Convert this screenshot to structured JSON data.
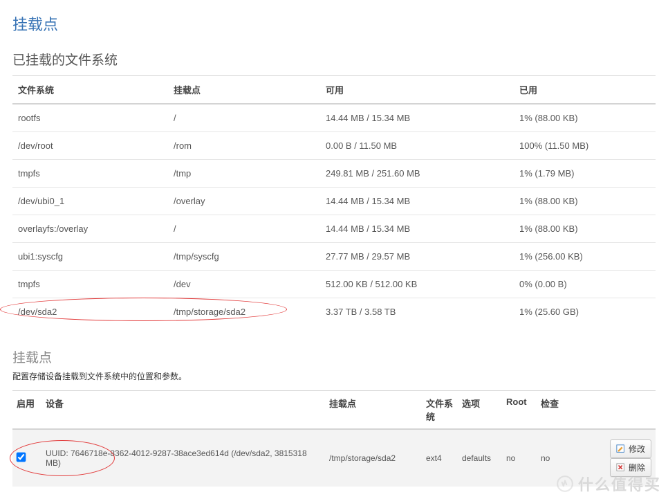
{
  "page": {
    "title": "挂载点"
  },
  "mounted": {
    "heading": "已挂载的文件系统",
    "columns": {
      "fs": "文件系统",
      "mount": "挂载点",
      "avail": "可用",
      "used": "已用"
    },
    "rows": [
      {
        "fs": "rootfs",
        "mount": "/",
        "avail": "14.44 MB / 15.34 MB",
        "used": "1% (88.00 KB)"
      },
      {
        "fs": "/dev/root",
        "mount": "/rom",
        "avail": "0.00 B / 11.50 MB",
        "used": "100% (11.50 MB)"
      },
      {
        "fs": "tmpfs",
        "mount": "/tmp",
        "avail": "249.81 MB / 251.60 MB",
        "used": "1% (1.79 MB)"
      },
      {
        "fs": "/dev/ubi0_1",
        "mount": "/overlay",
        "avail": "14.44 MB / 15.34 MB",
        "used": "1% (88.00 KB)"
      },
      {
        "fs": "overlayfs:/overlay",
        "mount": "/",
        "avail": "14.44 MB / 15.34 MB",
        "used": "1% (88.00 KB)"
      },
      {
        "fs": "ubi1:syscfg",
        "mount": "/tmp/syscfg",
        "avail": "27.77 MB / 29.57 MB",
        "used": "1% (256.00 KB)"
      },
      {
        "fs": "tmpfs",
        "mount": "/dev",
        "avail": "512.00 KB / 512.00 KB",
        "used": "0% (0.00 B)"
      },
      {
        "fs": "/dev/sda2",
        "mount": "/tmp/storage/sda2",
        "avail": "3.37 TB / 3.58 TB",
        "used": "1% (25.60 GB)"
      }
    ]
  },
  "mountpoints": {
    "heading": "挂载点",
    "desc": "配置存储设备挂载到文件系统中的位置和参数。",
    "columns": {
      "enable": "启用",
      "device": "设备",
      "mount": "挂载点",
      "fs": "文件系统",
      "options": "选项",
      "root": "Root",
      "check": "检查"
    },
    "rows": [
      {
        "enabled": true,
        "device": "UUID: 7646718e-8362-4012-9287-38ace3ed614d (/dev/sda2, 3815318 MB)",
        "mount": "/tmp/storage/sda2",
        "fs": "ext4",
        "options": "defaults",
        "root": "no",
        "check": "no"
      }
    ],
    "buttons": {
      "edit": "修改",
      "delete": "删除"
    }
  },
  "watermark": "什么值得买"
}
